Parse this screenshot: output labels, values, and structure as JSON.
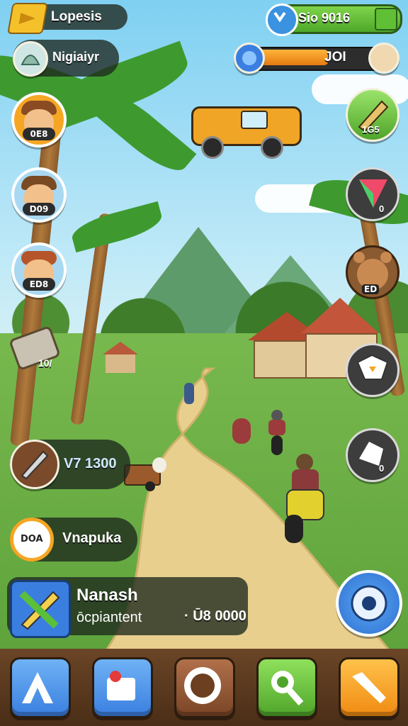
{
  "top_left": {
    "label": "Lopesis"
  },
  "currency": {
    "amount": "Sio 9016"
  },
  "location": {
    "label": "Nigiaiyr"
  },
  "energy": {
    "value": "JOI",
    "fill_fraction": 0.6
  },
  "left_avatars": [
    {
      "badge": "0E8"
    },
    {
      "badge": "D09"
    },
    {
      "badge": "ED8"
    }
  ],
  "left_item": {
    "value": "10/"
  },
  "tool_row": {
    "value": "V7 1300"
  },
  "quest_row": {
    "badge": "DOA",
    "label": "Vnapuka"
  },
  "task_card": {
    "title": "Nanash",
    "subtitle": "ōcpiantent",
    "value": "· Ū8 0000"
  },
  "right_pencil": {
    "value": "1G5"
  },
  "right_map": {
    "value": "0"
  },
  "right_bear": {
    "value": "ED"
  },
  "right_pin": {
    "value": "0"
  },
  "colors": {
    "accent": "#f5a623",
    "green": "#5bbf3a",
    "blue": "#2f7fe0",
    "brown": "#6b4526"
  },
  "icons": [
    "arrow-icon",
    "coin-icon",
    "compass-icon",
    "pencil-icon",
    "map-icon",
    "bear-icon",
    "chat-icon",
    "pin-icon",
    "gear-icon",
    "bottom-a-icon",
    "bottom-b-icon",
    "bottom-c-icon",
    "bottom-d-icon",
    "bottom-e-icon"
  ]
}
